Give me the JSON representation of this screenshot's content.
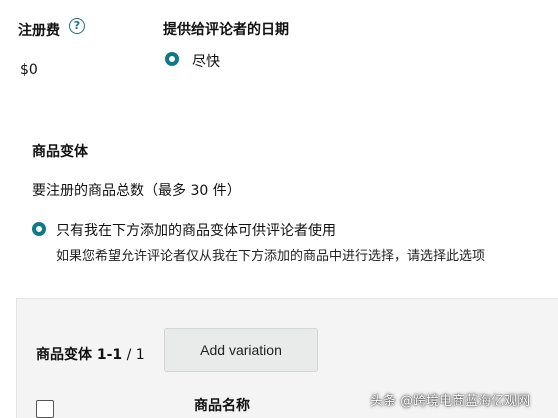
{
  "registration": {
    "fee_label": "注册费",
    "help_glyph": "?",
    "fee_value": "$0"
  },
  "reviewer_date": {
    "label": "提供给评论者的日期",
    "option_label": "尽快"
  },
  "variants": {
    "title": "商品变体",
    "total_line": "要注册的商品总数（最多 30 件）",
    "only_option_label": "只有我在下方添加的商品变体可供评论者使用",
    "only_option_help": "如果您希望允许评论者仅从我在下方添加的商品中进行选择，请选择此选项"
  },
  "table_panel": {
    "pager_prefix": "商品变体 1-1",
    "pager_sep": " / ",
    "pager_total": "1",
    "add_button_label": "Add variation",
    "column_product_name": "商品名称"
  },
  "watermark": "头条 @跨境电商蓝海亿观网",
  "colors": {
    "accent_teal": "#0f7a86",
    "help_icon": "#1a6f7c",
    "panel_bg": "#f4f4f4",
    "button_bg": "#e9ebeb"
  },
  "icons": {
    "help": "question-circle-icon",
    "radio": "radio-selected-icon",
    "checkbox": "checkbox-icon"
  }
}
